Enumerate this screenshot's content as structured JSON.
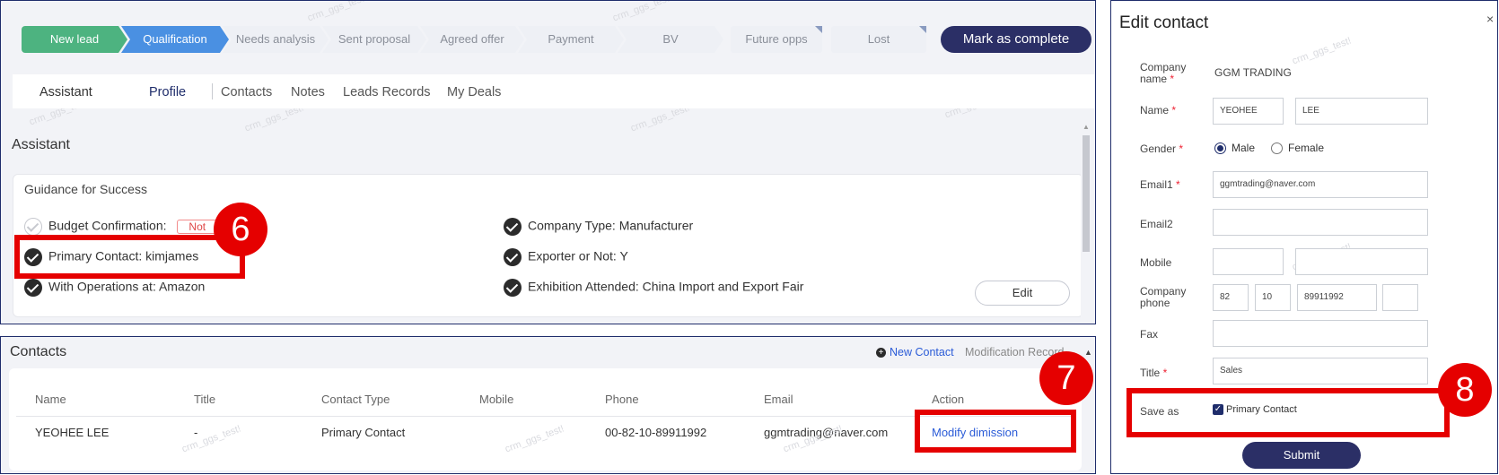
{
  "pipeline": {
    "stages": [
      {
        "label": "New lead",
        "state": "done"
      },
      {
        "label": "Qualification",
        "state": "active"
      },
      {
        "label": "Needs analysis",
        "state": "todo"
      },
      {
        "label": "Sent proposal",
        "state": "todo"
      },
      {
        "label": "Agreed offer",
        "state": "todo"
      },
      {
        "label": "Payment",
        "state": "todo"
      },
      {
        "label": "BV",
        "state": "todo"
      },
      {
        "label": "Future opps",
        "state": "todo"
      },
      {
        "label": "Lost",
        "state": "todo"
      }
    ],
    "mark_complete_label": "Mark as complete"
  },
  "tabs": {
    "assistant": "Assistant",
    "profile": "Profile",
    "contacts": "Contacts",
    "notes": "Notes",
    "leads_records": "Leads Records",
    "my_deals": "My Deals"
  },
  "assistant": {
    "title": "Assistant",
    "card_title": "Guidance for Success",
    "left_items": [
      {
        "label": "Budget Confirmation:",
        "value": "Not",
        "checked": false
      },
      {
        "label": "Primary Contact:",
        "value": "kimjames",
        "checked": true
      },
      {
        "label": "With Operations at:",
        "value": "Amazon",
        "checked": true
      }
    ],
    "right_items": [
      {
        "label": "Company Type:",
        "value": "Manufacturer",
        "checked": true
      },
      {
        "label": "Exporter or Not:",
        "value": "Y",
        "checked": true
      },
      {
        "label": "Exhibition Attended:",
        "value": "China Import and Export Fair",
        "checked": true
      }
    ],
    "edit_label": "Edit"
  },
  "contacts": {
    "title": "Contacts",
    "new_contact_label": "New Contact",
    "modification_record_label": "Modification Record",
    "columns": [
      "Name",
      "Title",
      "Contact Type",
      "Mobile",
      "Phone",
      "Email",
      "Action"
    ],
    "rows": [
      {
        "name": "YEOHEE LEE",
        "title": "-",
        "contact_type": "Primary Contact",
        "mobile": "",
        "phone": "00-82-10-89911992",
        "email": "ggmtrading@naver.com",
        "action": "Modify dimission"
      }
    ]
  },
  "edit_contact": {
    "title": "Edit contact",
    "company_name_label": "Company name",
    "company_name_value": "GGM TRADING",
    "name_label": "Name",
    "first_name": "YEOHEE",
    "last_name": "LEE",
    "gender_label": "Gender",
    "gender_options": [
      "Male",
      "Female"
    ],
    "gender_selected": "Male",
    "email1_label": "Email1",
    "email1_value": "ggmtrading@naver.com",
    "email2_label": "Email2",
    "mobile_label": "Mobile",
    "company_phone_label": "Company phone",
    "phone_parts": [
      "82",
      "10",
      "89911992",
      ""
    ],
    "fax_label": "Fax",
    "title_label": "Title",
    "title_value": "Sales",
    "save_as_label": "Save as",
    "primary_contact_label": "Primary Contact",
    "primary_contact_checked": true,
    "submit_label": "Submit"
  },
  "annotations": {
    "step6": "6",
    "step7": "7",
    "step8": "8"
  },
  "watermark": "crm_ggs_test!",
  "colors": {
    "done": "#4db380",
    "active": "#4a90e2",
    "todo": "#eef0f5",
    "navy": "#2b2f66",
    "highlight": "#e50000",
    "link": "#2a5bd7"
  }
}
